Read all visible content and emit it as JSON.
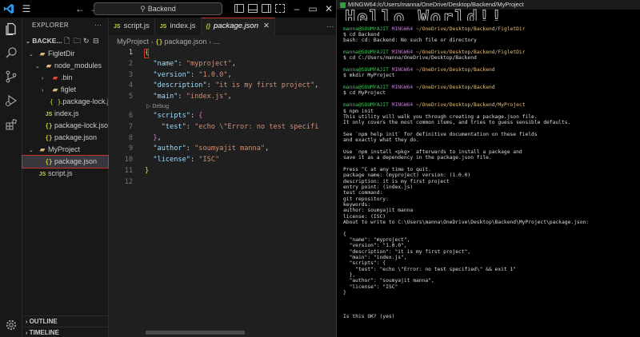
{
  "vscode": {
    "search_text": "Backend",
    "explorer_title": "EXPLORER",
    "workspace": "BACKE...",
    "tree": [
      {
        "label": "FigletDir",
        "type": "folder",
        "chev": "⌄",
        "indent": 1
      },
      {
        "label": "node_modules",
        "type": "folder",
        "chev": "⌄",
        "indent": 2
      },
      {
        "label": ".bin",
        "type": "bin",
        "chev": "›",
        "indent": 3
      },
      {
        "label": "figlet",
        "type": "folder",
        "chev": "›",
        "indent": 3
      },
      {
        "label": ".package-lock.j...",
        "type": "jsonbrace",
        "chev": "",
        "indent": 3
      },
      {
        "label": "index.js",
        "type": "js",
        "chev": "",
        "indent": 2
      },
      {
        "label": "package-lock.json",
        "type": "json",
        "chev": "",
        "indent": 2
      },
      {
        "label": "package.json",
        "type": "json",
        "chev": "",
        "indent": 2
      },
      {
        "label": "MyProject",
        "type": "folder",
        "chev": "⌄",
        "indent": 1
      },
      {
        "label": "package.json",
        "type": "json",
        "chev": "",
        "indent": 2,
        "selected": true
      },
      {
        "label": "script.js",
        "type": "js",
        "chev": "",
        "indent": 1
      }
    ],
    "outline_label": "OUTLINE",
    "timeline_label": "TIMELINE",
    "tabs": [
      {
        "label": "script.js",
        "icon": "JS",
        "active": false
      },
      {
        "label": "index.js",
        "icon": "JS",
        "active": false
      },
      {
        "label": "package.json",
        "icon": "{}",
        "active": true
      }
    ],
    "breadcrumbs": [
      "MyProject",
      "package.json",
      "..."
    ],
    "codelens": "▷ Debug",
    "code_lines": [
      {
        "n": "1",
        "html": "<span class=\"b1\">{</span>"
      },
      {
        "n": "2",
        "html": "  <span class=\"k\">\"name\"</span><span class=\"p\">: </span><span class=\"s\">\"myproject\"</span><span class=\"p\">,</span>"
      },
      {
        "n": "3",
        "html": "  <span class=\"k\">\"version\"</span><span class=\"p\">: </span><span class=\"s\">\"1.0.0\"</span><span class=\"p\">,</span>"
      },
      {
        "n": "4",
        "html": "  <span class=\"k\">\"description\"</span><span class=\"p\">: </span><span class=\"s\">\"it is my first project\"</span><span class=\"p\">,</span>"
      },
      {
        "n": "5",
        "html": "  <span class=\"k\">\"main\"</span><span class=\"p\">: </span><span class=\"s\">\"index.js\"</span><span class=\"p\">,</span>"
      },
      {
        "n": "6",
        "html": "  <span class=\"k\">\"scripts\"</span><span class=\"p\">: </span><span class=\"b2\">{</span>"
      },
      {
        "n": "7",
        "html": "    <span class=\"k\">\"test\"</span><span class=\"p\">: </span><span class=\"s\">\"echo \\\"Error: no test specifi</span>"
      },
      {
        "n": "8",
        "html": "  <span class=\"b2\">}</span><span class=\"p\">,</span>"
      },
      {
        "n": "9",
        "html": "  <span class=\"k\">\"author\"</span><span class=\"p\">: </span><span class=\"s\">\"soumyajit manna\"</span><span class=\"p\">,</span>"
      },
      {
        "n": "10",
        "html": "  <span class=\"k\">\"license\"</span><span class=\"p\">: </span><span class=\"s\">\"ISC\"</span>"
      },
      {
        "n": "11",
        "html": "<span class=\"b1\">}</span>"
      },
      {
        "n": "12",
        "html": ""
      }
    ]
  },
  "terminal": {
    "title": "MINGW64:/c/Users/manna/OneDrive/Desktop/Backend/MyProject",
    "banner": "Hello World!!",
    "lines": [
      {
        "t": "",
        "c": ""
      },
      {
        "t": "",
        "c": ""
      },
      {
        "t": "manna@SOUMYAJIT MINGW64 ~/OneDrive/Desktop/Backend/FigletDir",
        "c": "prompt"
      },
      {
        "t": "$ cd Backend",
        "c": ""
      },
      {
        "t": "bash: cd: Backend: No such file or directory",
        "c": ""
      },
      {
        "t": "",
        "c": ""
      },
      {
        "t": "manna@SOUMYAJIT MINGW64 ~/OneDrive/Desktop/Backend/FigletDir",
        "c": "prompt"
      },
      {
        "t": "$ cd C:/Users/manna/OneDrive/Desktop/Backend",
        "c": ""
      },
      {
        "t": "",
        "c": ""
      },
      {
        "t": "manna@SOUMYAJIT MINGW64 ~/OneDrive/Desktop/Backend",
        "c": "prompt"
      },
      {
        "t": "$ mkdir MyProject",
        "c": ""
      },
      {
        "t": "",
        "c": ""
      },
      {
        "t": "manna@SOUMYAJIT MINGW64 ~/OneDrive/Desktop/Backend",
        "c": "prompt"
      },
      {
        "t": "$ cd MyProject",
        "c": ""
      },
      {
        "t": "",
        "c": ""
      },
      {
        "t": "manna@SOUMYAJIT MINGW64 ~/OneDrive/Desktop/Backend/MyProject",
        "c": "prompt"
      },
      {
        "t": "$ npm init",
        "c": ""
      },
      {
        "t": "This utility will walk you through creating a package.json file.",
        "c": ""
      },
      {
        "t": "It only covers the most common items, and tries to guess sensible defaults.",
        "c": ""
      },
      {
        "t": "",
        "c": ""
      },
      {
        "t": "See `npm help init` for definitive documentation on these fields",
        "c": ""
      },
      {
        "t": "and exactly what they do.",
        "c": ""
      },
      {
        "t": "",
        "c": ""
      },
      {
        "t": "Use `npm install <pkg>` afterwards to install a package and",
        "c": ""
      },
      {
        "t": "save it as a dependency in the package.json file.",
        "c": ""
      },
      {
        "t": "",
        "c": ""
      },
      {
        "t": "Press ^C at any time to quit.",
        "c": ""
      },
      {
        "t": "package name: (myproject) version: (1.0.0)",
        "c": ""
      },
      {
        "t": "description: it is my first project",
        "c": ""
      },
      {
        "t": "entry point: (index.js)",
        "c": ""
      },
      {
        "t": "test command:",
        "c": ""
      },
      {
        "t": "git repository:",
        "c": ""
      },
      {
        "t": "keywords:",
        "c": ""
      },
      {
        "t": "author: soumyajit manna",
        "c": ""
      },
      {
        "t": "license: (ISC)",
        "c": ""
      },
      {
        "t": "About to write to C:\\Users\\manna\\OneDrive\\Desktop\\Backend\\MyProject\\package.json:",
        "c": ""
      },
      {
        "t": "",
        "c": ""
      },
      {
        "t": "{",
        "c": ""
      },
      {
        "t": "  \"name\": \"myproject\",",
        "c": ""
      },
      {
        "t": "  \"version\": \"1.0.0\",",
        "c": ""
      },
      {
        "t": "  \"description\": \"it is my first project\",",
        "c": ""
      },
      {
        "t": "  \"main\": \"index.js\",",
        "c": ""
      },
      {
        "t": "  \"scripts\": {",
        "c": ""
      },
      {
        "t": "    \"test\": \"echo \\\"Error: no test specified\\\" && exit 1\"",
        "c": ""
      },
      {
        "t": "  },",
        "c": ""
      },
      {
        "t": "  \"author\": \"soumyajit manna\",",
        "c": ""
      },
      {
        "t": "  \"license\": \"ISC\"",
        "c": ""
      },
      {
        "t": "}",
        "c": ""
      },
      {
        "t": "",
        "c": ""
      },
      {
        "t": "",
        "c": ""
      },
      {
        "t": "",
        "c": ""
      },
      {
        "t": "Is this OK? (yes)",
        "c": ""
      }
    ]
  },
  "colors": {
    "accent": "#c1392b",
    "prompt_user": "#3ec95b",
    "prompt_mingw": "#c678dd",
    "prompt_dir": "#e5c07b",
    "json_key": "#9cdcfe",
    "json_string": "#ce9178"
  }
}
